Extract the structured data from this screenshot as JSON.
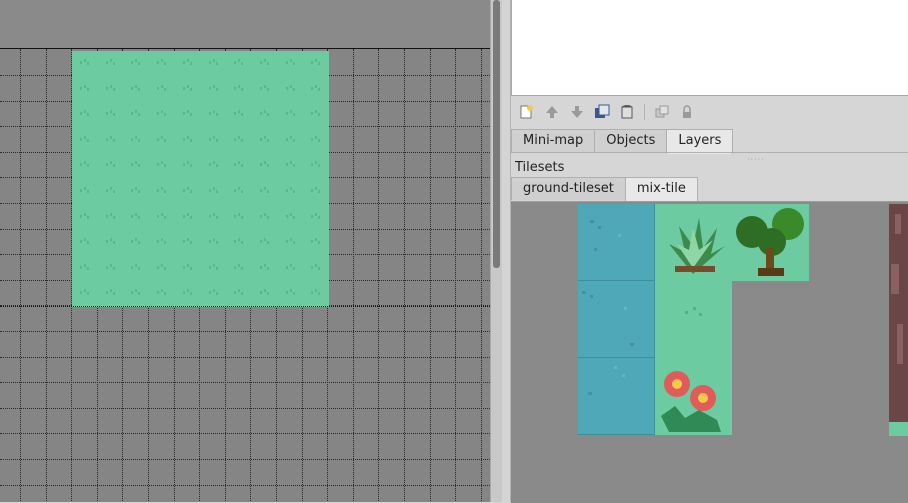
{
  "right_panel": {
    "dock_tabs": [
      {
        "label": "Mini-map",
        "active": false
      },
      {
        "label": "Objects",
        "active": false
      },
      {
        "label": "Layers",
        "active": true
      }
    ],
    "tilesets_title": "Tilesets",
    "tileset_tabs": [
      {
        "label": "ground-tileset",
        "active": false
      },
      {
        "label": "mix-tile",
        "active": true
      }
    ]
  },
  "layer_toolbar": {
    "icons": [
      "new-layer-icon",
      "raise-layer-icon",
      "lower-layer-icon",
      "duplicate-layer-icon",
      "remove-layer-icon",
      "toggle-other-layers-icon",
      "lock-layer-icon"
    ]
  },
  "colors": {
    "map_background": "#858585",
    "grass": "#6ccba0",
    "water": "#4fa8b8",
    "panel": "#d6d6d6"
  }
}
